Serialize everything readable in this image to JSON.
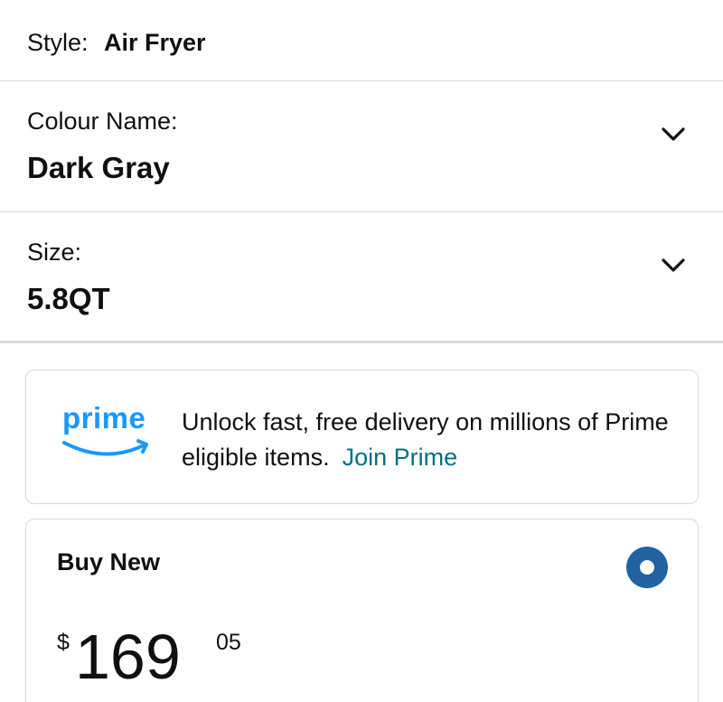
{
  "style": {
    "label": "Style:",
    "value": "Air Fryer"
  },
  "colour": {
    "label": "Colour Name:",
    "value": "Dark Gray"
  },
  "size": {
    "label": "Size:",
    "value": "5.8QT"
  },
  "prime": {
    "logo_text": "prime",
    "message": "Unlock fast, free delivery on millions of Prime eligible items.",
    "join_label": "Join Prime",
    "brand_color": "#1a98ff"
  },
  "buy_new": {
    "title": "Buy New",
    "price_symbol": "$",
    "price_whole": "169",
    "price_fraction": "05",
    "selected": true,
    "radio_color": "#2162a1"
  },
  "link_color": "#007185"
}
